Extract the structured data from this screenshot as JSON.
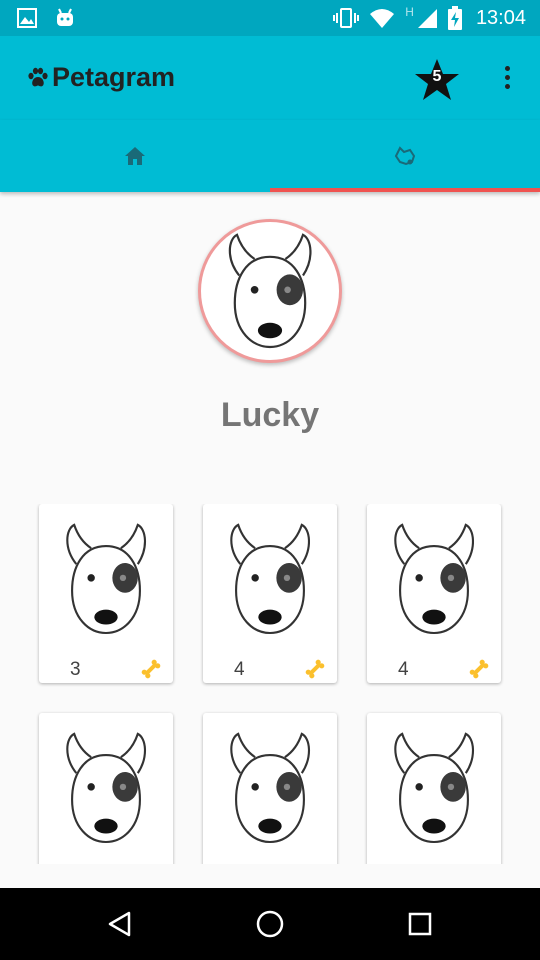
{
  "status_bar": {
    "time": "13:04",
    "network_letter": "H",
    "icons": [
      "image-icon",
      "android-icon",
      "vibrate-icon",
      "wifi-icon",
      "signal-icon",
      "battery-charging-icon"
    ]
  },
  "app_bar": {
    "title": "Petagram",
    "logo_icon": "paw-icon",
    "favorites_count": "5",
    "favorites_icon": "star-icon",
    "menu_icon": "more-vert-icon"
  },
  "tabs": [
    {
      "id": "home",
      "icon": "home-icon",
      "selected": false
    },
    {
      "id": "profile",
      "icon": "dog-icon",
      "selected": true
    }
  ],
  "colors": {
    "primary": "#00bcd4",
    "primary_dark": "#00a7bf",
    "accent": "#ef5350",
    "text_grey": "#757575",
    "bone": "#fbc02d"
  },
  "profile": {
    "name": "Lucky"
  },
  "photos": [
    {
      "likes": "3"
    },
    {
      "likes": "4"
    },
    {
      "likes": "4"
    },
    {
      "likes": ""
    },
    {
      "likes": ""
    },
    {
      "likes": ""
    }
  ],
  "nav_bar": {
    "buttons": [
      "back-icon",
      "home-circle-icon",
      "recents-icon"
    ]
  }
}
